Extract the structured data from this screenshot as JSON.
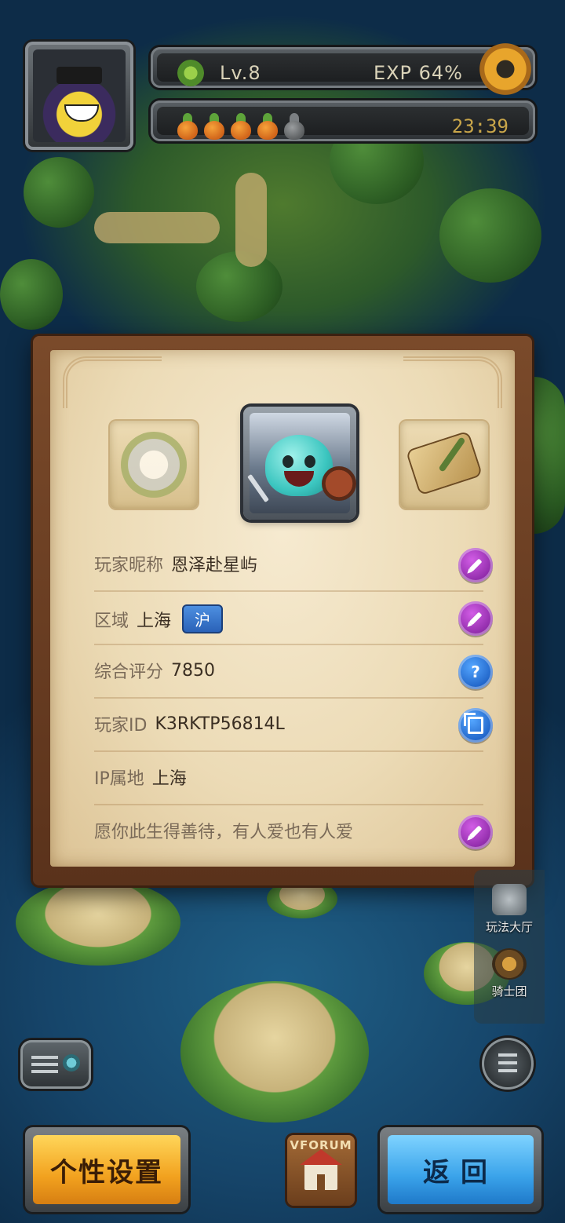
{
  "hud": {
    "level": "Lv.8",
    "exp": "EXP 64%",
    "time": "23:39",
    "carrots_total": 5,
    "carrots_filled": 4
  },
  "profile": {
    "rows": [
      {
        "label": "玩家昵称",
        "value": "恩泽赴星屿",
        "action_icon": "edit-icon"
      },
      {
        "label": "区域",
        "value": "上海",
        "tag": "沪",
        "action_icon": "edit-icon"
      },
      {
        "label": "综合评分",
        "value": "7850",
        "action_icon": "help-icon"
      },
      {
        "label": "玩家ID",
        "value": "K3RKTP56814L",
        "action_icon": "copy-icon"
      },
      {
        "label": "IP属地",
        "value": "上海"
      },
      {
        "label": "",
        "value": "愿你此生得善待，有人爱也有人爱",
        "action_icon": "edit-icon"
      }
    ],
    "help_glyph": "?"
  },
  "side_menu": {
    "items": [
      {
        "label": "玩法大厅",
        "icon": "gamepad-icon"
      },
      {
        "label": "骑士团",
        "icon": "trophy-icon"
      }
    ]
  },
  "forum": {
    "label": "VFORUM"
  },
  "buttons": {
    "personal": "个性设置",
    "back": "返回"
  },
  "colors": {
    "edit_button": "#8e2aa8",
    "info_button": "#1f63c7",
    "personal_button": "#f2a21f",
    "back_button": "#3aa3ea"
  }
}
